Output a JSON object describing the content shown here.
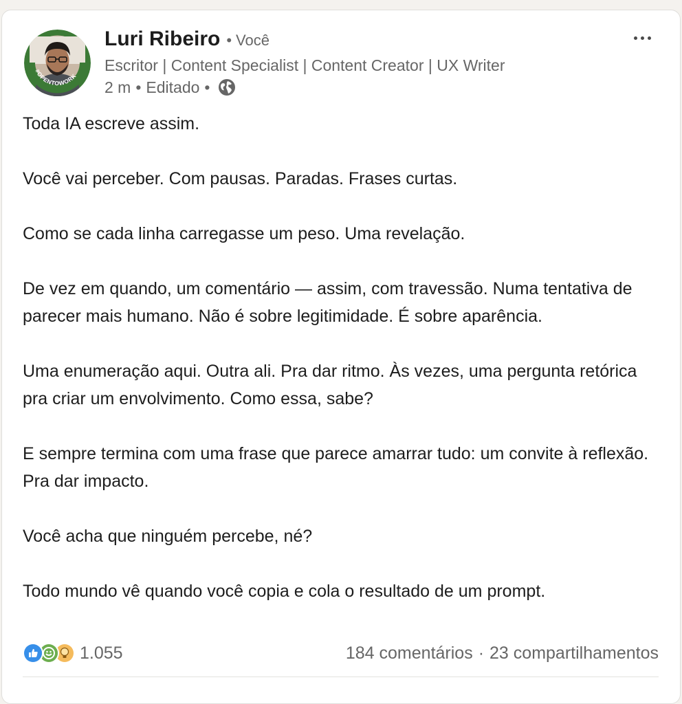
{
  "post": {
    "author": {
      "name": "Luri Ribeiro",
      "relation_separator": "•",
      "relation": "Você",
      "headline": "Escritor | Content Specialist | Content Creator | UX Writer",
      "time": "2 m",
      "edited": "Editado",
      "visibility_icon": "globe-icon",
      "avatar_frame_text": "#OPENTOWORK",
      "avatar_frame_color": "#3c7a36"
    },
    "menu_icon": "more-options-icon",
    "paragraphs": [
      "Toda IA escreve assim.",
      "Você vai perceber. Com pausas. Paradas. Frases curtas.",
      "Como se cada linha carregasse um peso. Uma revelação.",
      "De vez em quando, um comentário — assim, com travessão. Numa tentativa de parecer mais humano. Não é sobre legitimidade. É sobre aparência.",
      "Uma enumeração aqui. Outra ali. Pra dar ritmo. Às vezes, uma pergunta retórica pra criar um envolvimento. Como essa, sabe?",
      "E sempre termina com uma frase que parece amarrar tudo: um convite à reflexão. Pra dar impacto.",
      "Você acha que ninguém percebe, né?",
      "Todo mundo vê quando você copia e cola o resultado de um prompt."
    ],
    "social": {
      "reaction_icons": [
        "like-icon",
        "celebrate-icon",
        "insightful-icon"
      ],
      "reactions_count": "1.055",
      "comments": "184 comentários",
      "separator": "·",
      "shares": "23 compartilhamentos"
    }
  },
  "colors": {
    "page_bg": "#f4f2ee",
    "card_bg": "#ffffff",
    "text_primary": "#1d1d1d",
    "text_secondary": "#666666",
    "like_blue": "#378fe9",
    "celebrate_green": "#44712e",
    "insightful_yellow": "#f5bb5c"
  }
}
